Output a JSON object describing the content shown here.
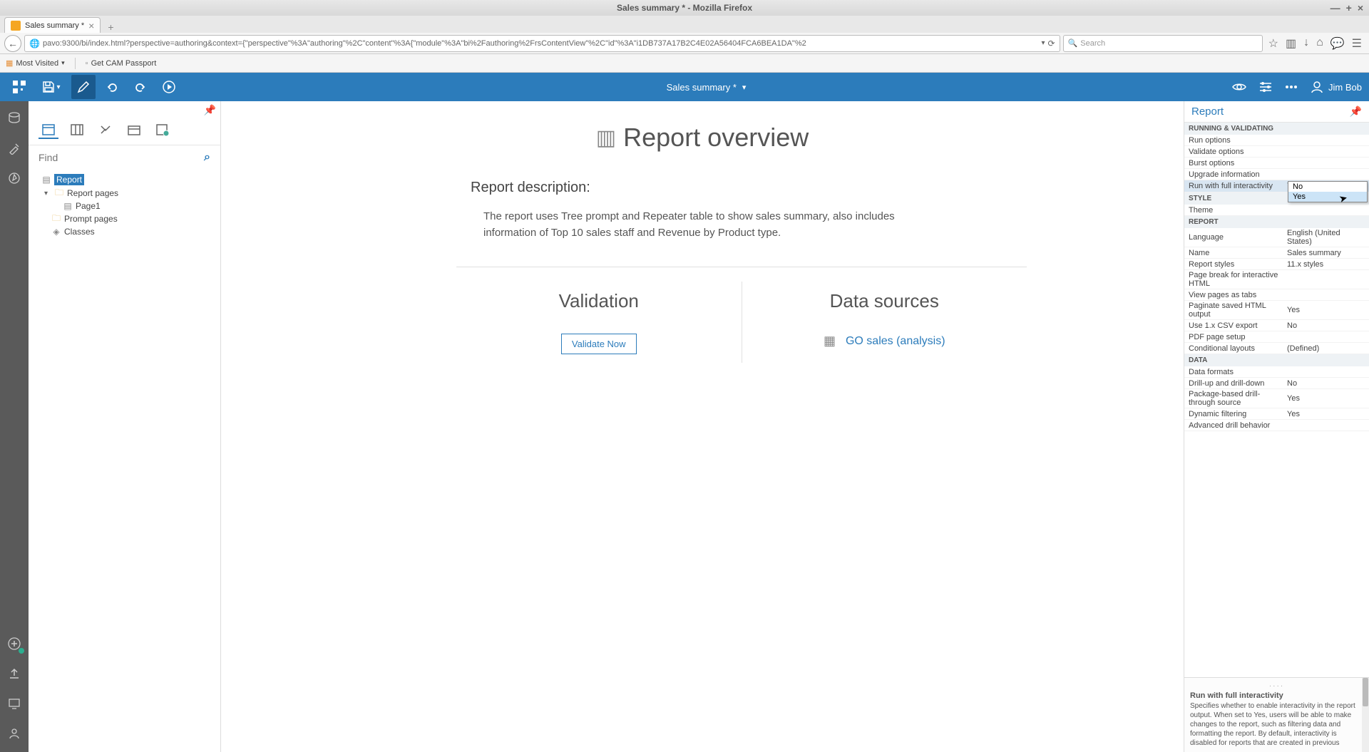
{
  "browser": {
    "window_title": "Sales summary * - Mozilla Firefox",
    "tab_title": "Sales summary *",
    "url": "pavo:9300/bi/index.html?perspective=authoring&context={\"perspective\"%3A\"authoring\"%2C\"content\"%3A{\"module\"%3A\"bi%2Fauthoring%2FrsContentView\"%2C\"id\"%3A\"i1DB737A17B2C4E02A56404FCA6BEA1DA\"%2",
    "search_placeholder": "Search",
    "bookmarks": {
      "most_visited": "Most Visited",
      "cam": "Get CAM Passport"
    }
  },
  "app_toolbar": {
    "doc_title": "Sales summary *",
    "user_name": "Jim Bob"
  },
  "explorer": {
    "find_placeholder": "Find",
    "tree": {
      "report": "Report",
      "report_pages": "Report pages",
      "page1": "Page1",
      "prompt_pages": "Prompt pages",
      "classes": "Classes"
    }
  },
  "center": {
    "title": "Report overview",
    "desc_label": "Report description:",
    "desc_text": "The report uses Tree prompt and Repeater table to show sales summary, also includes information of Top 10 sales staff and Revenue by Product type.",
    "validation_heading": "Validation",
    "validate_button": "Validate Now",
    "data_sources_heading": "Data sources",
    "data_source_link": "GO sales (analysis)"
  },
  "properties": {
    "title": "Report",
    "sections": {
      "running": "RUNNING & VALIDATING",
      "style": "STYLE",
      "report": "REPORT",
      "data": "DATA"
    },
    "rows": {
      "run_options": {
        "label": "Run options",
        "value": ""
      },
      "validate_options": {
        "label": "Validate options",
        "value": ""
      },
      "burst_options": {
        "label": "Burst options",
        "value": ""
      },
      "upgrade_info": {
        "label": "Upgrade information",
        "value": ""
      },
      "full_interactivity": {
        "label": "Run with full interactivity",
        "value": "Yes"
      },
      "theme": {
        "label": "Theme",
        "value": ""
      },
      "language": {
        "label": "Language",
        "value": "English (United States)"
      },
      "name": {
        "label": "Name",
        "value": "Sales summary"
      },
      "report_styles": {
        "label": "Report styles",
        "value": "11.x styles"
      },
      "page_break": {
        "label": "Page break for interactive HTML",
        "value": ""
      },
      "view_pages_tabs": {
        "label": "View pages as tabs",
        "value": ""
      },
      "paginate": {
        "label": "Paginate saved HTML output",
        "value": "Yes"
      },
      "csv_export": {
        "label": "Use 1.x CSV export",
        "value": "No"
      },
      "pdf_setup": {
        "label": "PDF page setup",
        "value": ""
      },
      "conditional": {
        "label": "Conditional layouts",
        "value": "(Defined)"
      },
      "data_formats": {
        "label": "Data formats",
        "value": ""
      },
      "drill_up_down": {
        "label": "Drill-up and drill-down",
        "value": "No"
      },
      "pkg_drill": {
        "label": "Package-based drill-through source",
        "value": "Yes"
      },
      "dynamic_filter": {
        "label": "Dynamic filtering",
        "value": "Yes"
      },
      "adv_drill": {
        "label": "Advanced drill behavior",
        "value": ""
      }
    },
    "dropdown_options": {
      "no": "No",
      "yes": "Yes"
    },
    "help": {
      "title": "Run with full interactivity",
      "text": "Specifies whether to enable interactivity in the report output. When set to Yes, users will be able to make changes to the report, such as filtering data and formatting the report. By default, interactivity is disabled for reports that are created in previous"
    }
  }
}
